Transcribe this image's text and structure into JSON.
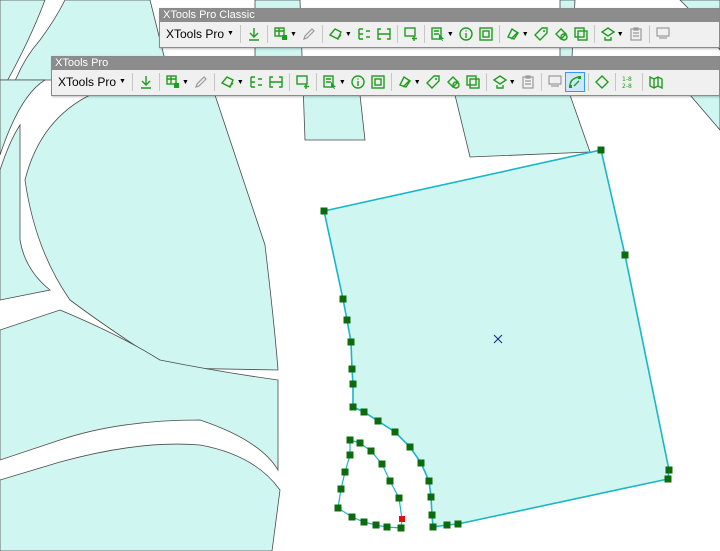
{
  "toolbars": [
    {
      "title": "XTools Pro Classic",
      "dropdown_label": "XTools Pro",
      "buttons": [
        {
          "icon": "download-icon",
          "dropdown": false,
          "enabled": true
        },
        "sep",
        {
          "icon": "table-tools-icon",
          "dropdown": true,
          "enabled": true
        },
        {
          "icon": "edit-pencil-icon",
          "dropdown": false,
          "enabled": false
        },
        "sep",
        {
          "icon": "shape-convert-icon",
          "dropdown": true,
          "enabled": true
        },
        {
          "icon": "split-shape-icon",
          "dropdown": false,
          "enabled": true
        },
        {
          "icon": "merge-shape-icon",
          "dropdown": false,
          "enabled": true
        },
        "sep",
        {
          "icon": "add-shape-icon",
          "dropdown": false,
          "enabled": true
        },
        "sep",
        {
          "icon": "select-features-icon",
          "dropdown": true,
          "enabled": true
        },
        {
          "icon": "info-icon",
          "dropdown": false,
          "enabled": true
        },
        {
          "icon": "attribute-table-icon",
          "dropdown": false,
          "enabled": true
        },
        "sep",
        {
          "icon": "overlay-icon",
          "dropdown": true,
          "enabled": true
        },
        {
          "icon": "tag-icon",
          "dropdown": false,
          "enabled": true
        },
        {
          "icon": "clean-shape-icon",
          "dropdown": false,
          "enabled": true
        },
        {
          "icon": "copy-layers-icon",
          "dropdown": false,
          "enabled": true
        },
        "sep",
        {
          "icon": "export-layer-icon",
          "dropdown": true,
          "enabled": true
        },
        {
          "icon": "clipboard-icon",
          "dropdown": false,
          "enabled": false
        },
        "sep",
        {
          "icon": "sql-query-icon",
          "dropdown": false,
          "enabled": false
        }
      ]
    },
    {
      "title": "XTools Pro",
      "dropdown_label": "XTools Pro",
      "buttons": [
        {
          "icon": "download-icon",
          "dropdown": false,
          "enabled": true
        },
        "sep",
        {
          "icon": "table-tools-icon",
          "dropdown": true,
          "enabled": true
        },
        {
          "icon": "edit-pencil-icon",
          "dropdown": false,
          "enabled": false
        },
        "sep",
        {
          "icon": "shape-convert-icon",
          "dropdown": true,
          "enabled": true
        },
        {
          "icon": "split-shape-icon",
          "dropdown": false,
          "enabled": true
        },
        {
          "icon": "merge-shape-icon",
          "dropdown": false,
          "enabled": true
        },
        "sep",
        {
          "icon": "add-shape-icon",
          "dropdown": false,
          "enabled": true
        },
        "sep",
        {
          "icon": "select-features-icon",
          "dropdown": true,
          "enabled": true
        },
        {
          "icon": "info-icon",
          "dropdown": false,
          "enabled": true
        },
        {
          "icon": "attribute-table-icon",
          "dropdown": false,
          "enabled": true
        },
        "sep",
        {
          "icon": "overlay-icon",
          "dropdown": true,
          "enabled": true
        },
        {
          "icon": "tag-icon",
          "dropdown": false,
          "enabled": true
        },
        {
          "icon": "clean-shape-icon",
          "dropdown": false,
          "enabled": true
        },
        {
          "icon": "copy-layers-icon",
          "dropdown": false,
          "enabled": true
        },
        "sep",
        {
          "icon": "export-layer-icon",
          "dropdown": true,
          "enabled": true
        },
        {
          "icon": "clipboard-icon",
          "dropdown": false,
          "enabled": false
        },
        "sep",
        {
          "icon": "sql-query-icon",
          "dropdown": false,
          "enabled": false
        },
        {
          "icon": "smooth-polygon-icon",
          "dropdown": false,
          "enabled": true,
          "active": true
        },
        "sep",
        {
          "icon": "diamond-shape-icon",
          "dropdown": false,
          "enabled": true
        },
        "sep",
        {
          "icon": "numbering-icon",
          "dropdown": false,
          "enabled": true
        },
        "sep",
        {
          "icon": "map-book-icon",
          "dropdown": false,
          "enabled": true
        }
      ]
    }
  ],
  "colors": {
    "parcel_fill": "#cff6f0",
    "parcel_outline": "#4a4a4a",
    "sketch_line": "#19b6c6",
    "vertex": "#0d6b0d",
    "current_vertex": "#e01010",
    "label_marker": "#1a2a8a"
  }
}
